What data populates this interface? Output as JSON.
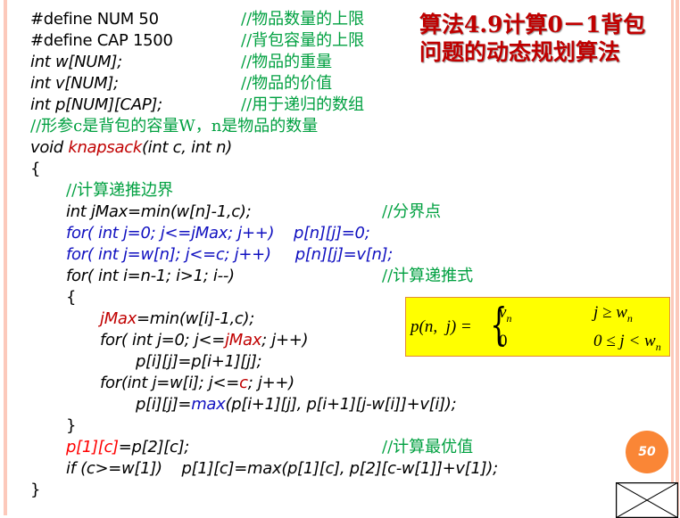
{
  "title": {
    "line1": "算法4.9计算0－1背包",
    "line2": "问题的动态规划算法"
  },
  "code": {
    "l1": "#define NUM 50",
    "l1c": "//物品数量的上限",
    "l2": "#define CAP 1500",
    "l2c": "//背包容量的上限",
    "l3": "int w[NUM];",
    "l3c": "//物品的重量",
    "l4": "int v[NUM];",
    "l4c": "//物品的价值",
    "l5": "int p[NUM][CAP];",
    "l5c": "//用于递归的数组",
    "l6c": "//形参c是背包的容量W，n是物品的数量",
    "l7a": "void ",
    "l7b": "knapsack",
    "l7c": "(int c, int n)",
    "l8": "{",
    "l9c": "//计算递推边界",
    "l10": "int jMax=min(w[n]-1,c);",
    "l10c": "//分界点",
    "l11": "for( int j=0; j<=jMax; j++)    p[n][j]=0;",
    "l12": "for( int j=w[n]; j<=c; j++)     p[n][j]=v[n];",
    "l13": "for( int i=n-1; i>1; i--)",
    "l13c": "//计算递推式",
    "l14": "{",
    "l15a": "jMax",
    "l15b": "=min(w[i]-1,c);",
    "l16a": "for( int j=0; j<=",
    "l16b": "jMax",
    "l16c": "; j++)",
    "l17": "p[i][j]=p[i+1][j];",
    "l18a": "for(int j=w[i]; j<=",
    "l18b": "c",
    "l18c": "; j++)",
    "l19a": "p[i][j]=",
    "l19b": "max",
    "l19c": "(p[i+1][j], p[i+1][j-w[i]]+v[i]);",
    "l20": "}",
    "l21a": "p[1][c]",
    "l21b": "=p[2][c];",
    "l21c": "//计算最优值",
    "l22": "if (c>=w[1])    p[1][c]=max(p[1][c], p[2][c-w[1]]+v[1]);",
    "l23": "}"
  },
  "formula": {
    "lhs": "p(n,  j) =",
    "case1_value": "v",
    "case1_sub": "n",
    "case1_cond": "j ≥ w",
    "case1_cond_sub": "n",
    "case2_value": "0",
    "case2_cond": "0 ≤ j < w",
    "case2_cond_sub": "n"
  },
  "page_number": "50"
}
